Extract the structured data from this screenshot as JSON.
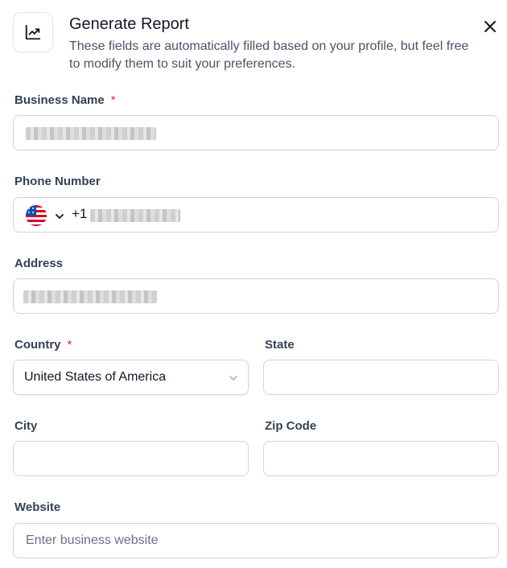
{
  "header": {
    "icon": "trending-up-icon",
    "title": "Generate Report",
    "subtitle": "These fields are automatically filled based on your profile, but feel free to modify them to suit your preferences.",
    "close_icon": "close-icon"
  },
  "form": {
    "business_name": {
      "label": "Business Name",
      "required_mark": "*"
    },
    "phone": {
      "label": "Phone Number",
      "country_flag": "us-flag-icon",
      "dial_code": "+1"
    },
    "address": {
      "label": "Address"
    },
    "country": {
      "label": "Country",
      "required_mark": "*",
      "selected": "United States of America"
    },
    "state": {
      "label": "State",
      "value": ""
    },
    "city": {
      "label": "City",
      "value": ""
    },
    "zip": {
      "label": "Zip Code",
      "value": ""
    },
    "website": {
      "label": "Website",
      "value": "",
      "placeholder": "Enter business website"
    }
  },
  "colors": {
    "required": "#d92d20",
    "border": "#d0d5dd",
    "label": "#344054",
    "muted": "#475467"
  }
}
